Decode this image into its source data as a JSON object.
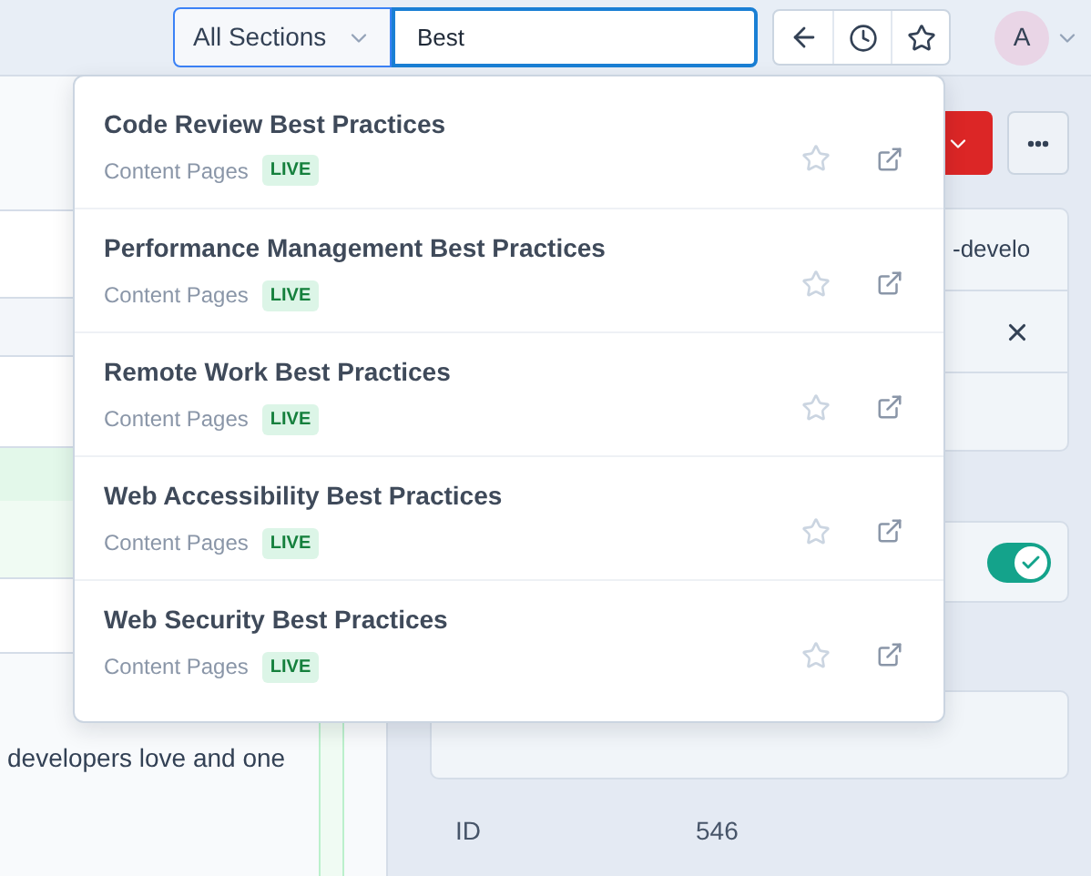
{
  "search": {
    "section": "All Sections",
    "value": "Best"
  },
  "nav_buttons": [
    {
      "kind": "back"
    },
    {
      "kind": "history"
    },
    {
      "kind": "favorite"
    }
  ],
  "user": {
    "initial": "A"
  },
  "results": [
    {
      "title": "Code Review Best Practices",
      "section": "Content Pages",
      "status": "LIVE",
      "starred": false
    },
    {
      "title": "Performance Management Best Practices",
      "section": "Content Pages",
      "status": "LIVE",
      "starred": false
    },
    {
      "title": "Remote Work Best Practices",
      "section": "Content Pages",
      "status": "LIVE",
      "starred": false
    },
    {
      "title": "Web Accessibility Best Practices",
      "section": "Content Pages",
      "status": "LIVE",
      "starred": false
    },
    {
      "title": "Web Security Best Practices",
      "section": "Content Pages",
      "status": "LIVE",
      "starred": false
    }
  ],
  "content": {
    "text": "developers love and one"
  },
  "sidebar": {
    "slug_fragment": "-develo",
    "toggle": {
      "on": true
    },
    "id_label": "ID",
    "id_value": "546"
  }
}
